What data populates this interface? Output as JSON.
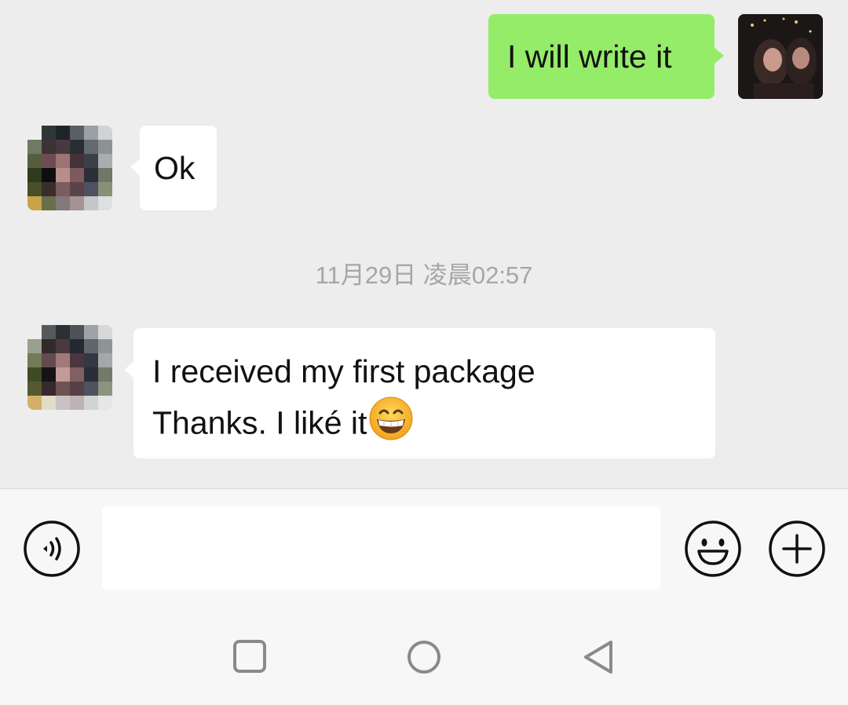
{
  "chat": {
    "messages": [
      {
        "sender": "me",
        "text": "I will write it"
      },
      {
        "sender": "contact",
        "text": "Ok"
      },
      {
        "sender": "contact",
        "lines": [
          "I received my first package",
          "Thanks. I liké it"
        ],
        "trailing_emoji": "grinning-face-with-smiling-eyes"
      }
    ],
    "timestamp": "11月29日 凌晨02:57"
  },
  "input_bar": {
    "voice_icon": "voice-icon",
    "input_value": "",
    "emoji_icon": "emoji-icon",
    "more_icon": "plus-icon"
  },
  "navigation": {
    "recents_icon": "square-icon",
    "home_icon": "circle-icon",
    "back_icon": "triangle-back-icon"
  },
  "colors": {
    "background": "#ededed",
    "my_bubble": "#95ec69",
    "their_bubble": "#ffffff",
    "timestamp_text": "#a6a6a6"
  }
}
